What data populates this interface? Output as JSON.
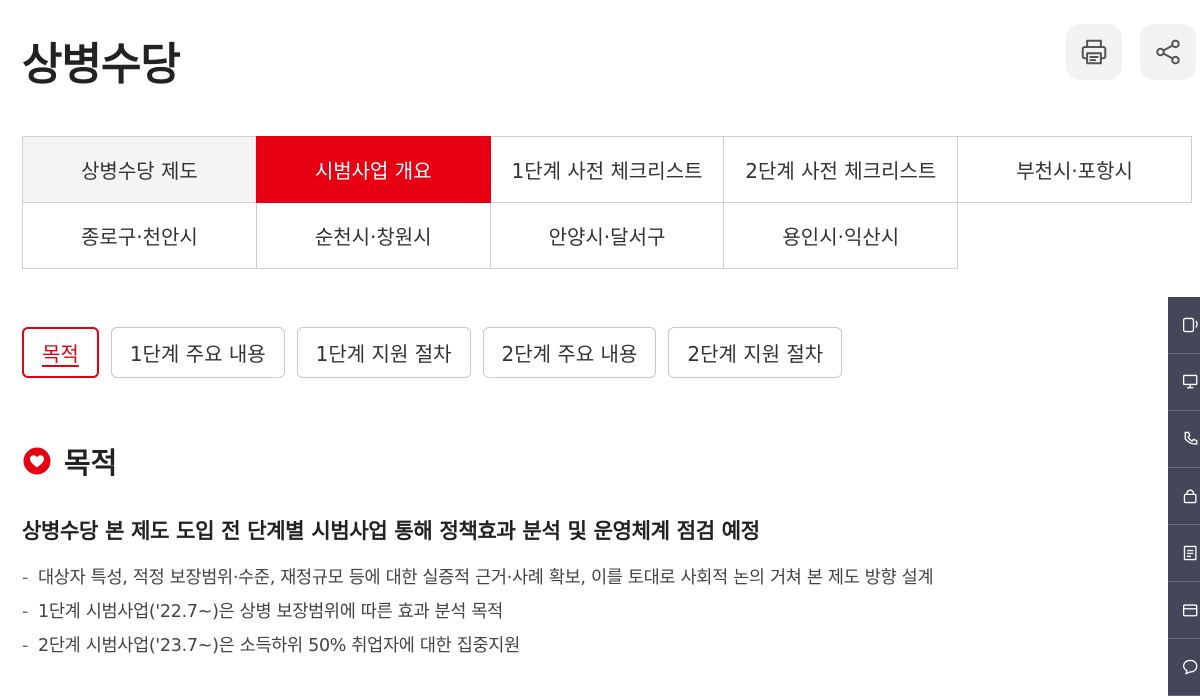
{
  "header": {
    "title": "상병수당",
    "print_icon": "printer-icon",
    "share_icon": "share-icon"
  },
  "main_tabs": [
    {
      "label": "상병수당 제도"
    },
    {
      "label": "시범사업 개요",
      "active": true
    },
    {
      "label": "1단계 사전 체크리스트"
    },
    {
      "label": "2단계 사전 체크리스트"
    },
    {
      "label": "부천시·포항시"
    },
    {
      "label": "종로구·천안시"
    },
    {
      "label": "순천시·창원시"
    },
    {
      "label": "안양시·달서구"
    },
    {
      "label": "용인시·익산시"
    }
  ],
  "sub_tabs": [
    {
      "label": "목적",
      "active": true
    },
    {
      "label": "1단계 주요 내용"
    },
    {
      "label": "1단계 지원 절차"
    },
    {
      "label": "2단계 주요 내용"
    },
    {
      "label": "2단계 지원 절차"
    }
  ],
  "section": {
    "title": "목적",
    "lead": "상병수당 본 제도 도입 전 단계별 시범사업 통해 정책효과 분석 및 운영체계 점검 예정",
    "bullets": [
      "대상자 특성, 적정 보장범위·수준, 재정규모 등에 대한 실증적 근거·사례 확보, 이를 토대로 사회적 논의 거쳐 본 제도 방향 설계",
      "1단계 시범사업('22.7~)은 상병 보장범위에 따른 효과 분석 목적",
      "2단계 시범사업('23.7~)은 소득하위 50% 취업자에 대한 집중지원"
    ]
  },
  "colors": {
    "accent": "#e60012",
    "quick_bar": "#44475a"
  },
  "quick_menu_icons": [
    "mobile-icon",
    "monitor-icon",
    "phone-icon",
    "lock-icon",
    "document-icon",
    "card-icon",
    "chat-icon"
  ]
}
